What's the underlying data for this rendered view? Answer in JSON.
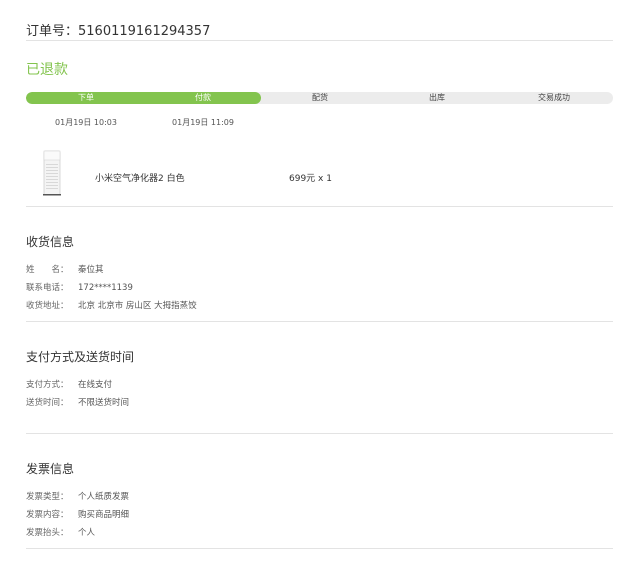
{
  "order": {
    "number_label": "订单号：5160119161294357",
    "status": "已退款"
  },
  "progress": {
    "fraction": 0.4,
    "accent": "#83c44e",
    "steps": [
      {
        "label": "下单",
        "done": true
      },
      {
        "label": "付款",
        "done": true
      },
      {
        "label": "配货",
        "done": false
      },
      {
        "label": "出库",
        "done": false
      },
      {
        "label": "交易成功",
        "done": false
      }
    ],
    "times": [
      "01月19日 10:03",
      "01月19日 11:09"
    ]
  },
  "product": {
    "name": "小米空气净化器2 白色",
    "price_qty": "699元 x 1",
    "icon": "air-purifier-image"
  },
  "delivery": {
    "title": "收货信息",
    "name_label": "姓　　名：",
    "name_value": "秦位其",
    "phone_label": "联系电话：",
    "phone_value": "172****1139",
    "address_label": "收货地址：",
    "address_value": "北京 北京市 房山区 大拇指蒸饺"
  },
  "payment": {
    "title": "支付方式及送货时间",
    "method_label": "支付方式：",
    "method_value": "在线支付",
    "time_label": "送货时间：",
    "time_value": "不限送货时间"
  },
  "invoice": {
    "title": "发票信息",
    "type_label": "发票类型：",
    "type_value": "个人纸质发票",
    "content_label": "发票内容：",
    "content_value": "购买商品明细",
    "header_label": "发票抬头：",
    "header_value": "个人"
  }
}
